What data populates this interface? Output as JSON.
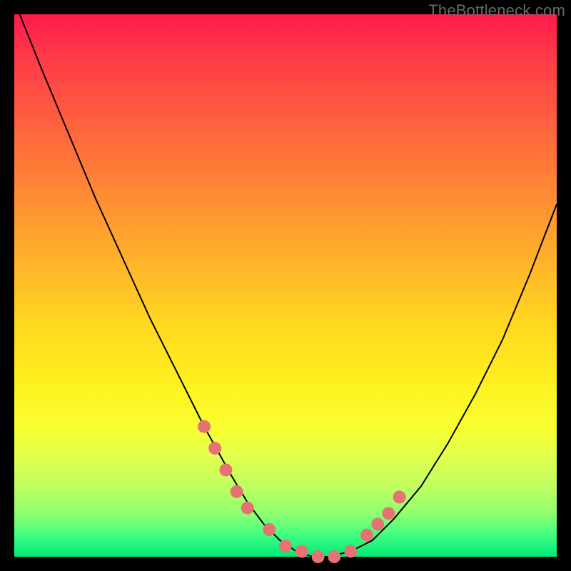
{
  "watermark": "TheBottleneck.com",
  "chart_data": {
    "type": "line",
    "title": "",
    "xlabel": "",
    "ylabel": "",
    "xlim": [
      0,
      100
    ],
    "ylim": [
      0,
      100
    ],
    "series": [
      {
        "name": "bottleneck-curve",
        "x": [
          1,
          5,
          10,
          15,
          20,
          25,
          30,
          35,
          40,
          43,
          46,
          49,
          52,
          55,
          58,
          62,
          66,
          70,
          75,
          80,
          85,
          90,
          95,
          100
        ],
        "values": [
          100,
          90,
          78,
          66,
          55,
          44,
          34,
          24,
          15,
          10,
          6,
          3,
          1,
          0,
          0,
          1,
          3,
          7,
          13,
          21,
          30,
          40,
          52,
          65
        ]
      }
    ],
    "markers": {
      "name": "salmon-dots",
      "color": "#e57373",
      "x": [
        35,
        37,
        39,
        41,
        43,
        47,
        50,
        53,
        56,
        59,
        62,
        65,
        67,
        69,
        71
      ],
      "values": [
        24,
        20,
        16,
        12,
        9,
        5,
        2,
        1,
        0,
        0,
        1,
        4,
        6,
        8,
        11
      ]
    }
  }
}
